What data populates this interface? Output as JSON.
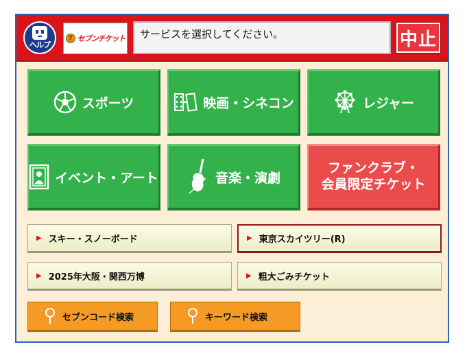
{
  "header": {
    "help_label": "ヘルプ",
    "logo_mark": "7",
    "logo_text": "セブンチケット",
    "message": "サービスを選択してください。",
    "cancel_label": "中止"
  },
  "categories": [
    {
      "label": "スポーツ",
      "icon": "soccer-ball-icon"
    },
    {
      "label": "映画・シネコン",
      "icon": "film-strip-icon"
    },
    {
      "label": "レジャー",
      "icon": "ferris-wheel-icon"
    },
    {
      "label": "イベント・アート",
      "icon": "picture-frame-icon"
    },
    {
      "label": "音楽・演劇",
      "icon": "violin-icon"
    },
    {
      "label_line1": "ファンクラブ・",
      "label_line2": "会員限定チケット"
    }
  ],
  "sub_items": [
    {
      "label": "スキー・スノーボード"
    },
    {
      "label": "東京スカイツリー(R)"
    },
    {
      "label": "2025年大阪・関西万博"
    },
    {
      "label": "粗大ごみチケット"
    }
  ],
  "search": {
    "seven_code": "セブンコード検索",
    "keyword": "キーワード検索"
  },
  "colors": {
    "header_red": "#d9141b",
    "category_green": "#33b14a",
    "fanclub_red": "#ea4b4b",
    "search_orange": "#f59a25",
    "background": "#fdeed8",
    "frame_blue": "#2c64b3"
  }
}
